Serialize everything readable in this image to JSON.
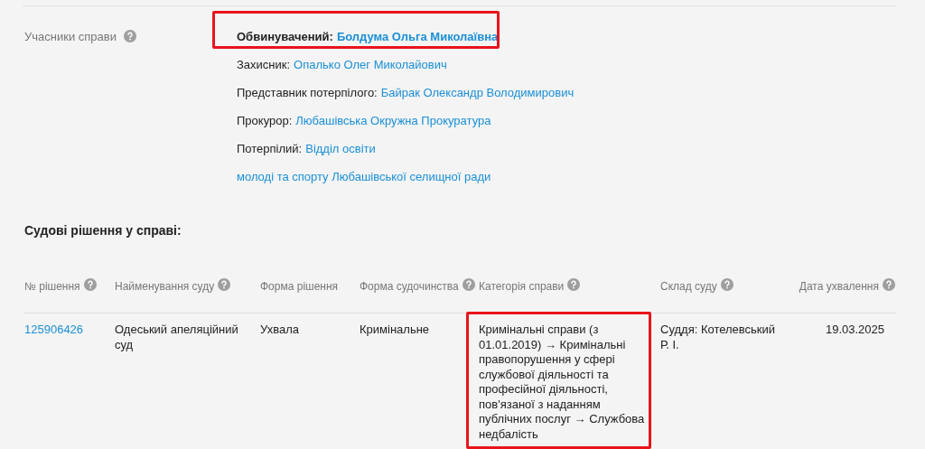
{
  "participants": {
    "label": "Учасники справи",
    "help": true,
    "items": [
      {
        "role": "Обвинувачений:",
        "name": "Болдума Ольга Миколаївна",
        "emphasized": true,
        "highlighted": true
      },
      {
        "role": "Захисник:",
        "name": "Опалько Олег Миколайович",
        "emphasized": false,
        "highlighted": false
      },
      {
        "role": "Представник потерпілого:",
        "name": "Байрак Олександр Володимирович",
        "emphasized": false,
        "highlighted": false
      },
      {
        "role": "Прокурор:",
        "name": "Любашівська Окружна Прокуратура",
        "emphasized": false,
        "highlighted": false
      },
      {
        "role": "Потерпілий:",
        "name": "Відділ освіти",
        "emphasized": false,
        "highlighted": false
      },
      {
        "name": "молоді та спорту Любашівської селищної ради",
        "emphasized": false,
        "highlighted": false
      }
    ]
  },
  "decisions": {
    "title": "Судові рішення у справі:",
    "columns": [
      {
        "label": "№ рішення",
        "help": true
      },
      {
        "label": "Найменування суду",
        "help": true
      },
      {
        "label": "Форма рішення",
        "help": false
      },
      {
        "label": "Форма судочинства",
        "help": true
      },
      {
        "label": "Категорія справи",
        "help": true
      },
      {
        "label": "Склад суду",
        "help": true
      },
      {
        "label": "Дата ухвалення",
        "help": true
      }
    ],
    "rows": [
      {
        "cells": [
          {
            "text": "125906426",
            "kind": "link",
            "highlighted": false
          },
          {
            "text": "Одеський апеляційний суд",
            "kind": "text",
            "highlighted": false
          },
          {
            "text": "Ухвала",
            "kind": "text",
            "highlighted": false
          },
          {
            "text": "Кримінальне",
            "kind": "text",
            "highlighted": false
          },
          {
            "text": "Кримінальні справи (з 01.01.2019) → Кримінальні правопорушення у сфері службової діяльності та професійної діяльності, пов'язаної з наданням публічних послуг → Службова недбалість",
            "kind": "text",
            "highlighted": true
          },
          {
            "text": "Суддя: Котелевський Р. І.",
            "kind": "text",
            "highlighted": false
          },
          {
            "text": "19.03.2025",
            "kind": "date",
            "highlighted": false
          }
        ]
      }
    ]
  }
}
